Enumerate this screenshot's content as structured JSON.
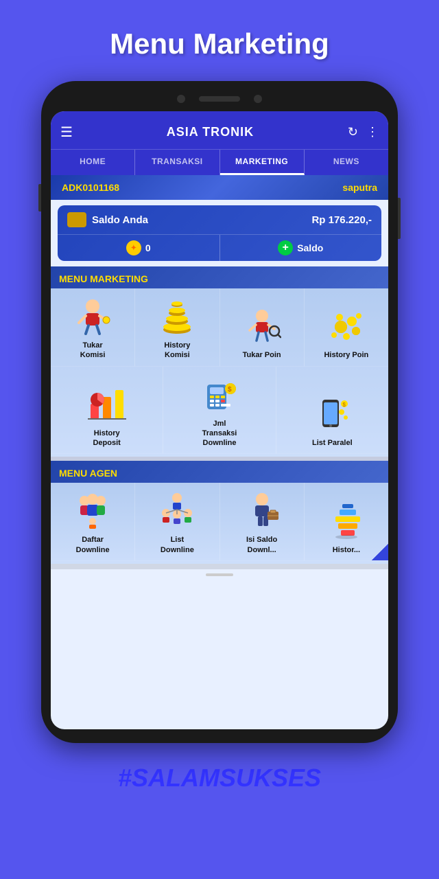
{
  "page": {
    "title": "Menu Marketing",
    "hashtag": "#SALAMSUKSES",
    "bg_color": "#5555ee"
  },
  "app": {
    "name": "ASIA TRONIK",
    "tabs": [
      "HOME",
      "TRANSAKSI",
      "MARKETING",
      "NEWS"
    ],
    "active_tab": "MARKETING"
  },
  "user": {
    "id": "ADK0101168",
    "name": "saputra"
  },
  "saldo": {
    "label": "Saldo Anda",
    "amount": "Rp 176.220,-",
    "poin": "0",
    "saldo_btn": "Saldo"
  },
  "menu_marketing": {
    "header": "MENU MARKETING",
    "items_row1": [
      {
        "label": "Tukar\nKomisi",
        "icon": "💰"
      },
      {
        "label": "History\nKomisi",
        "icon": "🪙"
      },
      {
        "label": "Tukar Poin",
        "icon": "🔍"
      },
      {
        "label": "History Poin",
        "icon": "💛"
      }
    ],
    "items_row2": [
      {
        "label": "History\nDeposit",
        "icon": "📊"
      },
      {
        "label": "Jml\nTransaksi\nDownline",
        "icon": "🧮"
      },
      {
        "label": "List Paralel",
        "icon": "📱"
      }
    ]
  },
  "menu_agen": {
    "header": "MENU AGEN",
    "items": [
      {
        "label": "Daftar\nDownline",
        "icon": "👨‍👩‍👧"
      },
      {
        "label": "List\nDownline",
        "icon": "👥"
      },
      {
        "label": "Isi Saldo\nDownl...",
        "icon": "💼"
      },
      {
        "label": "Histor...",
        "icon": "📈"
      }
    ]
  },
  "icons": {
    "hamburger": "☰",
    "refresh": "↻",
    "more": "⋮",
    "wallet": "👛",
    "poin_coin": "✦",
    "plus": "+"
  }
}
